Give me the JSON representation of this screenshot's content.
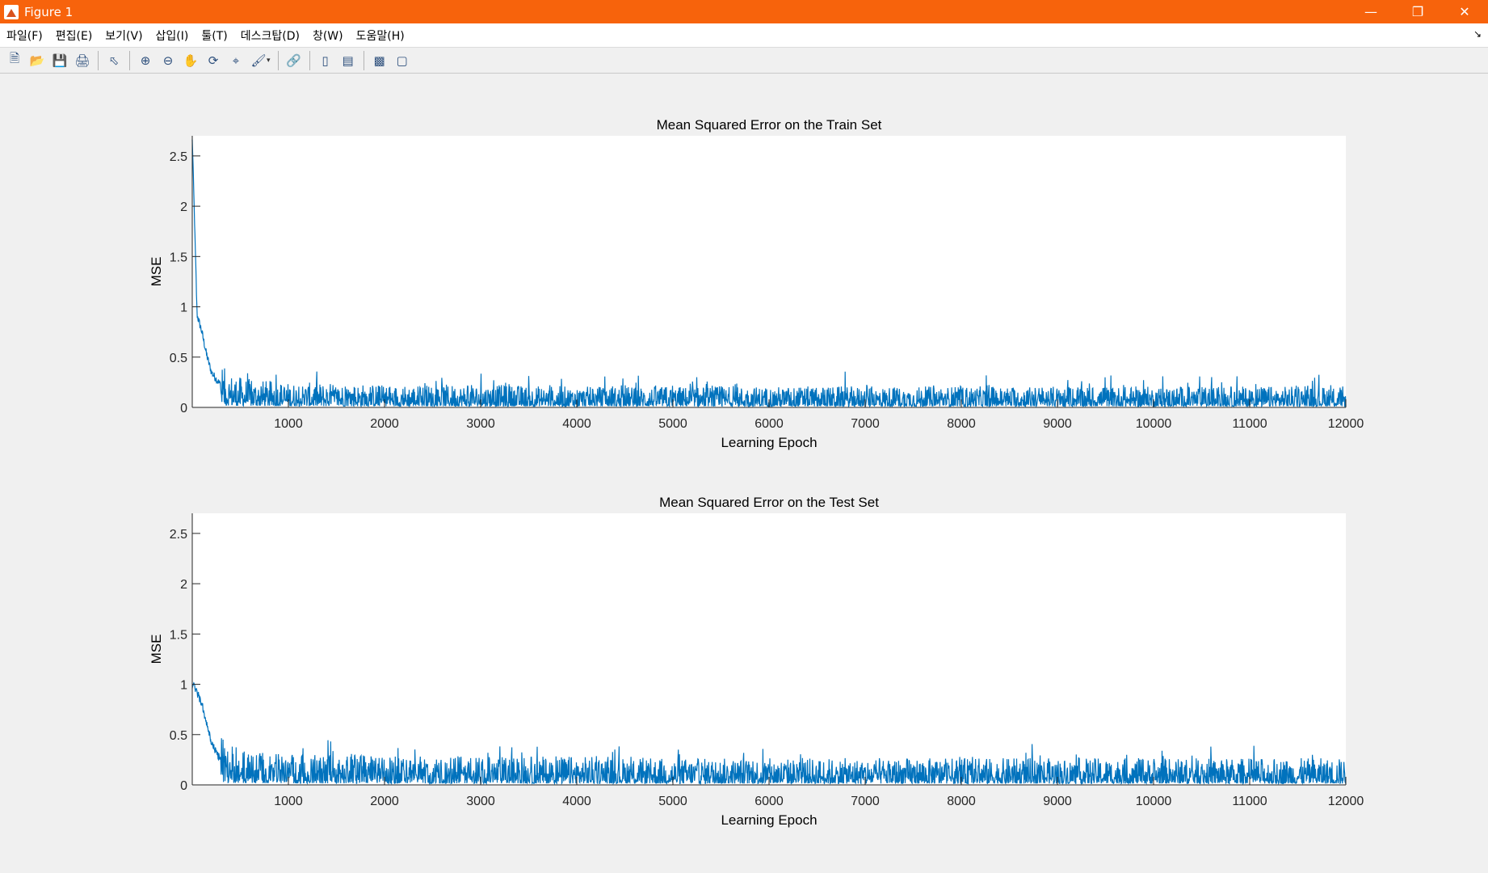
{
  "window": {
    "title": "Figure 1"
  },
  "menubar": {
    "items": [
      "파일(F)",
      "편집(E)",
      "보기(V)",
      "삽입(I)",
      "툴(T)",
      "데스크탑(D)",
      "창(W)",
      "도움말(H)"
    ]
  },
  "toolbar": {
    "icons": [
      "new-figure-icon",
      "open-file-icon",
      "save-icon",
      "print-icon",
      "select-arrow-icon",
      "zoom-in-icon",
      "zoom-out-icon",
      "pan-hand-icon",
      "rotate-3d-icon",
      "data-cursor-icon",
      "brush-icon",
      "link-plot-icon",
      "colorbar-icon",
      "legend-icon",
      "hide-plot-tools-icon",
      "show-plot-tools-icon"
    ]
  },
  "colors": {
    "line": "#0072bd",
    "titlebar": "#f7630c",
    "axes_bg": "#ffffff",
    "figure_bg": "#f0f0f0"
  },
  "chart_data": [
    {
      "type": "line",
      "title": "Mean Squared Error on the Train Set",
      "xlabel": "Learning Epoch",
      "ylabel": "MSE",
      "xlim": [
        0,
        12000
      ],
      "ylim": [
        0,
        2.7
      ],
      "xticks": [
        1000,
        2000,
        3000,
        4000,
        5000,
        6000,
        7000,
        8000,
        9000,
        10000,
        11000,
        12000
      ],
      "xtick_labels": [
        "1000",
        "2000",
        "3000",
        "4000",
        "5000",
        "6000",
        "7000",
        "8000",
        "9000",
        "10000",
        "11000",
        "12000"
      ],
      "yticks": [
        0,
        0.5,
        1,
        1.5,
        2,
        2.5
      ],
      "ytick_labels": [
        "0",
        "0.5",
        "1",
        "1.5",
        "2",
        "2.5"
      ],
      "grid": false,
      "series": [
        {
          "x": [
            1,
            50,
            100,
            150,
            200,
            250,
            300,
            400,
            500,
            600,
            800,
            1000,
            1500,
            2000,
            3000,
            4000,
            5000,
            6000,
            7000,
            8000,
            9000,
            10000,
            11000,
            12000
          ],
          "values": [
            2.65,
            0.92,
            0.75,
            0.52,
            0.35,
            0.28,
            0.22,
            0.18,
            0.16,
            0.15,
            0.14,
            0.13,
            0.13,
            0.12,
            0.12,
            0.11,
            0.11,
            0.11,
            0.11,
            0.11,
            0.11,
            0.11,
            0.11,
            0.11
          ],
          "noise_max": 0.45
        }
      ]
    },
    {
      "type": "line",
      "title": "Mean Squared Error on the Test Set",
      "xlabel": "Learning Epoch",
      "ylabel": "MSE",
      "xlim": [
        0,
        12000
      ],
      "ylim": [
        0,
        2.7
      ],
      "xticks": [
        1000,
        2000,
        3000,
        4000,
        5000,
        6000,
        7000,
        8000,
        9000,
        10000,
        11000,
        12000
      ],
      "xtick_labels": [
        "1000",
        "2000",
        "3000",
        "4000",
        "5000",
        "6000",
        "7000",
        "8000",
        "9000",
        "10000",
        "11000",
        "12000"
      ],
      "yticks": [
        0,
        0.5,
        1,
        1.5,
        2,
        2.5
      ],
      "ytick_labels": [
        "0",
        "0.5",
        "1",
        "1.5",
        "2",
        "2.5"
      ],
      "grid": false,
      "series": [
        {
          "x": [
            1,
            50,
            100,
            150,
            200,
            250,
            300,
            400,
            500,
            600,
            800,
            1000,
            1500,
            2000,
            3000,
            4000,
            5000,
            6000,
            7000,
            8000,
            9000,
            10000,
            11000,
            12000
          ],
          "values": [
            1.0,
            0.92,
            0.8,
            0.6,
            0.42,
            0.32,
            0.25,
            0.21,
            0.19,
            0.18,
            0.17,
            0.16,
            0.16,
            0.15,
            0.15,
            0.15,
            0.14,
            0.14,
            0.14,
            0.14,
            0.14,
            0.14,
            0.14,
            0.14
          ],
          "noise_max": 0.55
        }
      ]
    }
  ]
}
